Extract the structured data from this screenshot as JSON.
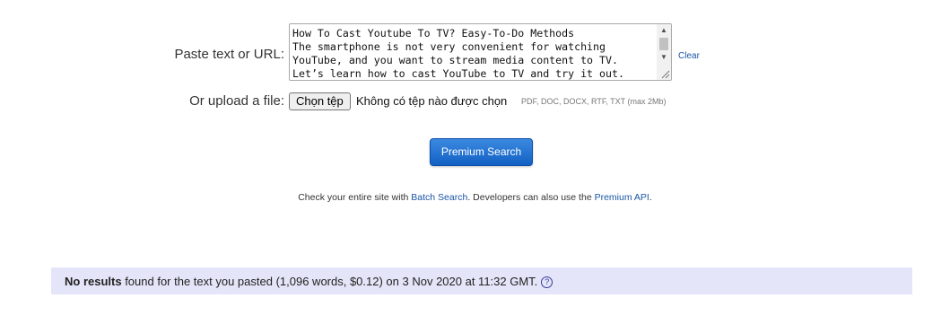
{
  "form": {
    "paste_label": "Paste text or URL:",
    "pasted_text": "How To Cast Youtube To TV? Easy-To-Do Methods\nThe smartphone is not very convenient for watching\nYouTube, and you want to stream media content to TV.\nLet’s learn how to cast YouTube to TV and try it out.",
    "clear_label": "Clear",
    "upload_label": "Or upload a file:",
    "choose_file_button": "Chọn tệp",
    "no_file_text": "Không có tệp nào được chọn",
    "file_formats": "PDF, DOC, DOCX, RTF, TXT (max 2Mb)",
    "scroll_position": 0.0
  },
  "premium_search_button": "Premium Search",
  "info": {
    "prefix": "Check your entire site with ",
    "batch_search_link": "Batch Search",
    "middle": ". Developers can also use the ",
    "premium_api_link": "Premium API",
    "suffix": "."
  },
  "results": {
    "no_results_bold": "No results",
    "message": " found for the text you pasted (1,096 words, $0.12) on 3 Nov 2020 at 11:32 GMT.",
    "help_icon": "?"
  },
  "colors": {
    "link": "#1a55a6",
    "button": "#1260c4",
    "results_bg": "#e4e5f8"
  }
}
